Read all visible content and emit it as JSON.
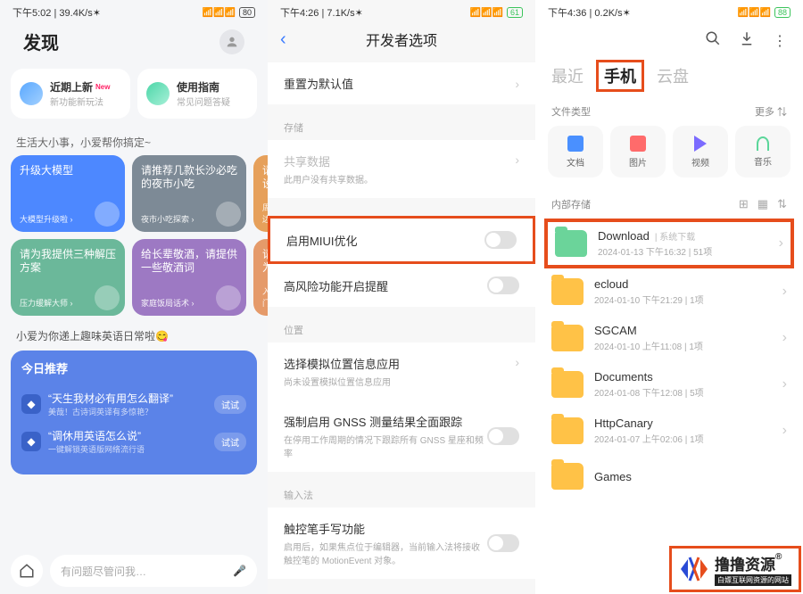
{
  "phone1": {
    "time": "下午5:02",
    "net": "39.4K/s",
    "batt": "80",
    "title": "发现",
    "card1": {
      "title": "近期上新",
      "sub": "新功能新玩法",
      "tag": "New"
    },
    "card2": {
      "title": "使用指南",
      "sub": "常见问题答疑"
    },
    "tip": "生活大小事，小爱帮你搞定~",
    "suggest": [
      {
        "title": "升级大模型",
        "foot": "大模型升级啦 ›"
      },
      {
        "title": "请推荐几款长沙必吃的夜市小吃",
        "foot": "夜市小吃探索 ›"
      },
      {
        "title": "请设…",
        "foot": "周边…"
      },
      {
        "title": "请为我提供三种解压方案",
        "foot": "压力缓解大师 ›"
      },
      {
        "title": "给长辈敬酒，请提供一些敬酒词",
        "foot": "家庭饭局话术 ›"
      },
      {
        "title": "请为…",
        "foot": "入门…"
      }
    ],
    "engTip": "小爱为你递上趣味英语日常啦😋",
    "recommend": {
      "title": "今日推荐",
      "items": [
        {
          "q": "“天生我材必有用怎么翻译”",
          "sub": "美哉！古诗词英译有多惊艳？",
          "try": "试试"
        },
        {
          "q": "“调休用英语怎么说”",
          "sub": "一键解锁英语版网络流行语",
          "try": "试试"
        }
      ]
    },
    "search": "有问题尽管问我…"
  },
  "phone2": {
    "time": "下午4:26",
    "net": "7.1K/s",
    "batt": "61",
    "title": "开发者选项",
    "reset": "重置为默认值",
    "groups": {
      "storage": "存储",
      "share": "共享数据",
      "share_sub": "此用户没有共享数据。",
      "miui": "启用MIUI优化",
      "risk": "高风险功能开启提醒",
      "location": "位置",
      "mock": "选择模拟位置信息应用",
      "mock_sub": "尚未设置模拟位置信息应用",
      "gnss": "强制启用 GNSS 测量结果全面跟踪",
      "gnss_sub": "在停用工作周期的情况下跟踪所有 GNSS 星座和频率",
      "ime": "输入法",
      "stylus": "触控笔手写功能",
      "stylus_sub": "启用后，如果焦点位于编辑器，当前输入法将接收触控笔的 MotionEvent 对象。"
    }
  },
  "phone3": {
    "time": "下午4:36",
    "net": "0.2K/s",
    "batt": "88",
    "tabs": [
      "最近",
      "手机",
      "云盘"
    ],
    "ft_label": "文件类型",
    "more": "更多",
    "types": [
      "文档",
      "图片",
      "视频",
      "音乐"
    ],
    "storage": "内部存储",
    "folders": [
      {
        "name": "Download",
        "tag": "系统下载",
        "meta": "2024-01-13 下午16:32  |  51项"
      },
      {
        "name": "ecloud",
        "meta": "2024-01-10 下午21:29  |  1项"
      },
      {
        "name": "SGCAM",
        "meta": "2024-01-10 上午11:08  |  1项"
      },
      {
        "name": "Documents",
        "meta": "2024-01-08 下午12:08  |  5项"
      },
      {
        "name": "HttpCanary",
        "meta": "2024-01-07 上午02:06  |  1项"
      },
      {
        "name": "Games",
        "meta": ""
      }
    ]
  },
  "watermark": {
    "big": "撸撸资源",
    "small": "白嫖互联网资源的网站"
  }
}
